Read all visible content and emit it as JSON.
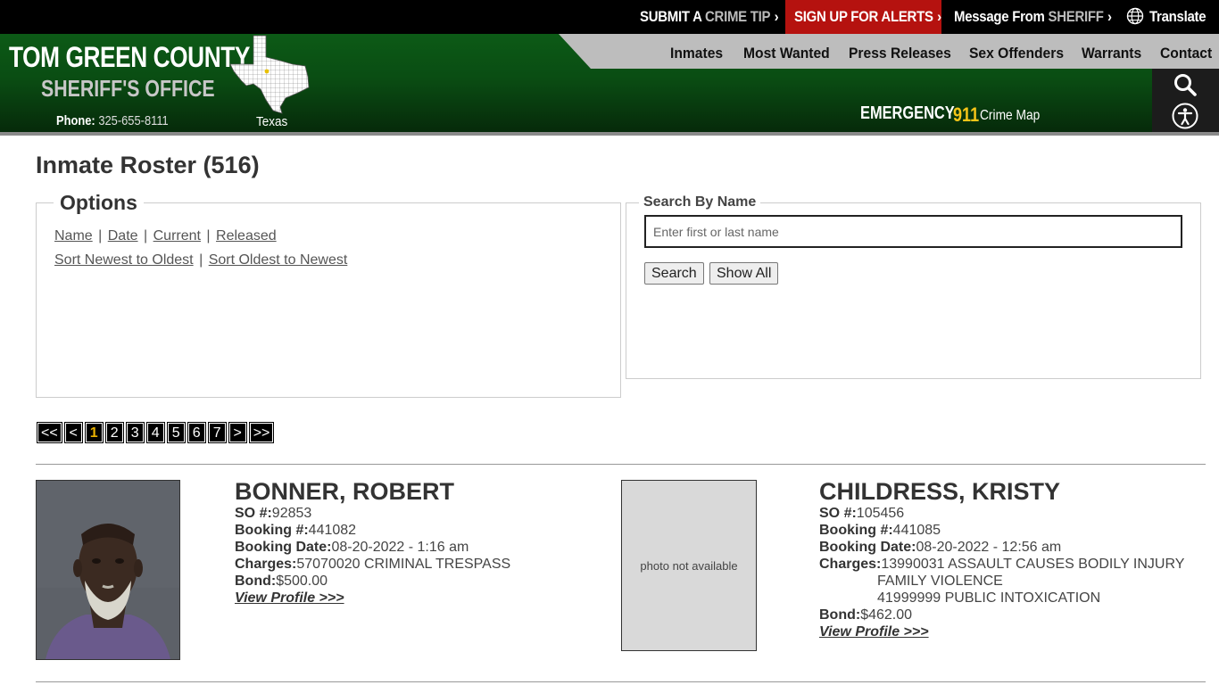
{
  "topbar": {
    "crime_tip": {
      "bold": "SUBMIT A",
      "light": "CRIME TIP"
    },
    "alerts": "SIGN UP FOR ALERTS",
    "sheriff_msg": {
      "bold": "Message From",
      "light": "SHERIFF"
    },
    "translate": "Translate",
    "chevron": "›"
  },
  "header": {
    "title": "TOM GREEN COUNTY",
    "subtitle": "SHERIFF'S OFFICE",
    "phone_label": "Phone:",
    "phone_number": "325-655-8111",
    "state": "Texas",
    "emergency_label": "EMERGENCY",
    "emergency_number": "911",
    "crime_map": "Crime Map"
  },
  "nav": [
    "Inmates",
    "Most Wanted",
    "Press Releases",
    "Sex Offenders",
    "Warrants",
    "Contact"
  ],
  "page": {
    "title": "Inmate Roster (516)"
  },
  "options": {
    "legend": "Options",
    "filter_links": [
      "Name",
      "Date",
      "Current",
      "Released"
    ],
    "sort_links": [
      "Sort Newest to Oldest",
      "Sort Oldest to Newest"
    ],
    "separator": "|"
  },
  "search": {
    "legend": "Search By Name",
    "placeholder": "Enter first or last name",
    "value": "",
    "search_button": "Search",
    "show_all_button": "Show All"
  },
  "pager": {
    "first": "<<",
    "prev": "<",
    "pages": [
      "1",
      "2",
      "3",
      "4",
      "5",
      "6",
      "7"
    ],
    "current": "1",
    "next": ">",
    "last": ">>"
  },
  "inmates": [
    {
      "name": "BONNER, ROBERT",
      "so_label": "SO #:",
      "so": "92853",
      "booking_label": "Booking #:",
      "booking": "441082",
      "date_label": "Booking Date:",
      "date": "08-20-2022 - 1:16 am",
      "charges_label": "Charges:",
      "charges": [
        "57070020 CRIMINAL TRESPASS"
      ],
      "bond_label": "Bond:",
      "bond": "$500.00",
      "view_profile": "View Profile >>>",
      "photo": "mugshot"
    },
    {
      "name": "CHILDRESS, KRISTY",
      "so_label": "SO #:",
      "so": "105456",
      "booking_label": "Booking #:",
      "booking": "441085",
      "date_label": "Booking Date:",
      "date": "08-20-2022 - 12:56 am",
      "charges_label": "Charges:",
      "charges": [
        "13990031 ASSAULT CAUSES BODILY INJURY",
        "FAMILY VIOLENCE",
        "41999999 PUBLIC INTOXICATION"
      ],
      "bond_label": "Bond:",
      "bond": "$462.00",
      "view_profile": "View Profile >>>",
      "photo_text": "photo not available"
    }
  ],
  "colors": {
    "alert_red": "#b5120f",
    "header_green": "#0a4d13",
    "emergency_yellow": "#f5c518",
    "pager_current": "#e8b000"
  },
  "icons": [
    "globe-icon",
    "chevron-right-icon",
    "texas-map-icon",
    "search-icon",
    "accessibility-icon"
  ]
}
